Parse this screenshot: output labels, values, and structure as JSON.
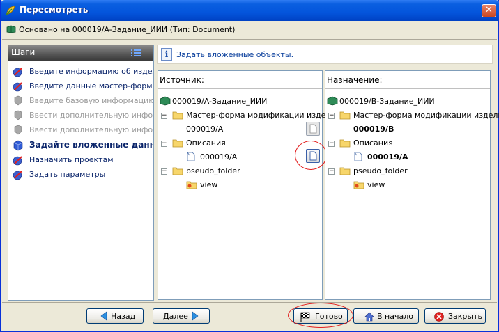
{
  "window": {
    "title": "Пересмотреть",
    "close_glyph": "✕"
  },
  "based_on": "Основано на 000019/A-Задание_ИИИ (Тип: Document)",
  "steps": {
    "header": "Шаги",
    "items": [
      {
        "label": "Введите информацию об изделии",
        "state": "done"
      },
      {
        "label": "Введите данные мастер-формы м",
        "state": "done"
      },
      {
        "label": "Введите базовую информацию ид",
        "state": "disabled"
      },
      {
        "label": "Ввести дополнительную информа",
        "state": "disabled"
      },
      {
        "label": "Ввести дополнительную информа",
        "state": "disabled"
      },
      {
        "label": "Задайте вложенные данные",
        "state": "current"
      },
      {
        "label": "Назначить проектам",
        "state": "done"
      },
      {
        "label": "Задать параметры",
        "state": "done"
      }
    ]
  },
  "info": {
    "icon": "i",
    "text": "Задать вложенные объекты."
  },
  "source": {
    "header": "Источник:",
    "root": "000019/A-Задание_ИИИ",
    "nodes": [
      {
        "label": "Мастер-форма модификации изде"
      },
      {
        "label": "000019/A"
      },
      {
        "label": "Описания"
      },
      {
        "label": "000019/A"
      },
      {
        "label": "pseudo_folder"
      },
      {
        "label": "view"
      }
    ]
  },
  "destination": {
    "header": "Назначение:",
    "root": "000019/B-Задание_ИИИ",
    "nodes": [
      {
        "label": "Мастер-форма модификации изделия"
      },
      {
        "label": "000019/B"
      },
      {
        "label": "Описания"
      },
      {
        "label": "000019/A"
      },
      {
        "label": "pseudo_folder"
      },
      {
        "label": "view"
      }
    ]
  },
  "buttons": {
    "back": "Назад",
    "next": "Далее",
    "finish": "Готово",
    "start": "В начало",
    "close": "Закрыть"
  },
  "icons": {
    "title": "app-leaf-icon",
    "basedon": "book-icon",
    "steps_list": "list-icon",
    "step_done": "check-pencil-icon",
    "step_disabled": "grey-shield-icon",
    "step_current": "blue-cube-icon",
    "folder": "folder-icon",
    "document": "document-icon",
    "view": "folder-view-icon"
  },
  "colors": {
    "title_blue": "#0455dc",
    "highlight_red": "#e21d1d",
    "step_text": "#0a246a",
    "disabled_text": "#9a9a9a"
  }
}
